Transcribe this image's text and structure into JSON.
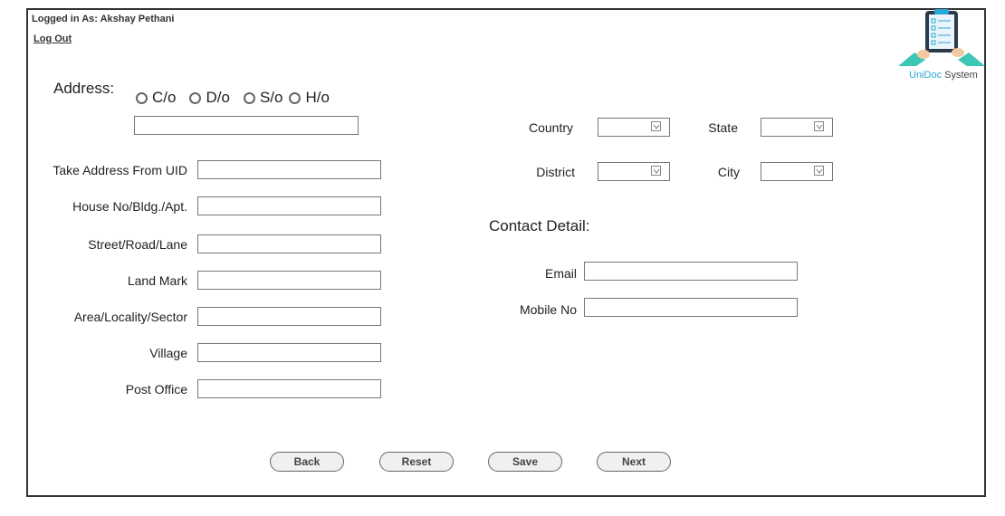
{
  "header": {
    "logged_in_text": "Logged in As: Akshay Pethani",
    "logout_label": "Log Out"
  },
  "logo": {
    "brand_part1": "UniDoc",
    "brand_part2": " System",
    "colors": {
      "accent": "#2aa7d6",
      "teal": "#3cc7b5"
    }
  },
  "address": {
    "title": "Address:",
    "relations": [
      "C/o",
      "D/o",
      "S/o",
      "H/o"
    ],
    "fields": [
      {
        "label": "Take Address From UID",
        "value": ""
      },
      {
        "label": "House No/Bldg./Apt.",
        "value": ""
      },
      {
        "label": "Street/Road/Lane",
        "value": ""
      },
      {
        "label": "Land Mark",
        "value": ""
      },
      {
        "label": "Area/Locality/Sector",
        "value": ""
      },
      {
        "label": "Village",
        "value": ""
      },
      {
        "label": "Post Office",
        "value": ""
      }
    ]
  },
  "location": {
    "country_label": "Country",
    "state_label": "State",
    "district_label": "District",
    "city_label": "City"
  },
  "contact": {
    "title": "Contact Detail:",
    "email_label": "Email",
    "mobile_label": "Mobile No"
  },
  "buttons": {
    "back": "Back",
    "reset": "Reset",
    "save": "Save",
    "next": "Next"
  }
}
